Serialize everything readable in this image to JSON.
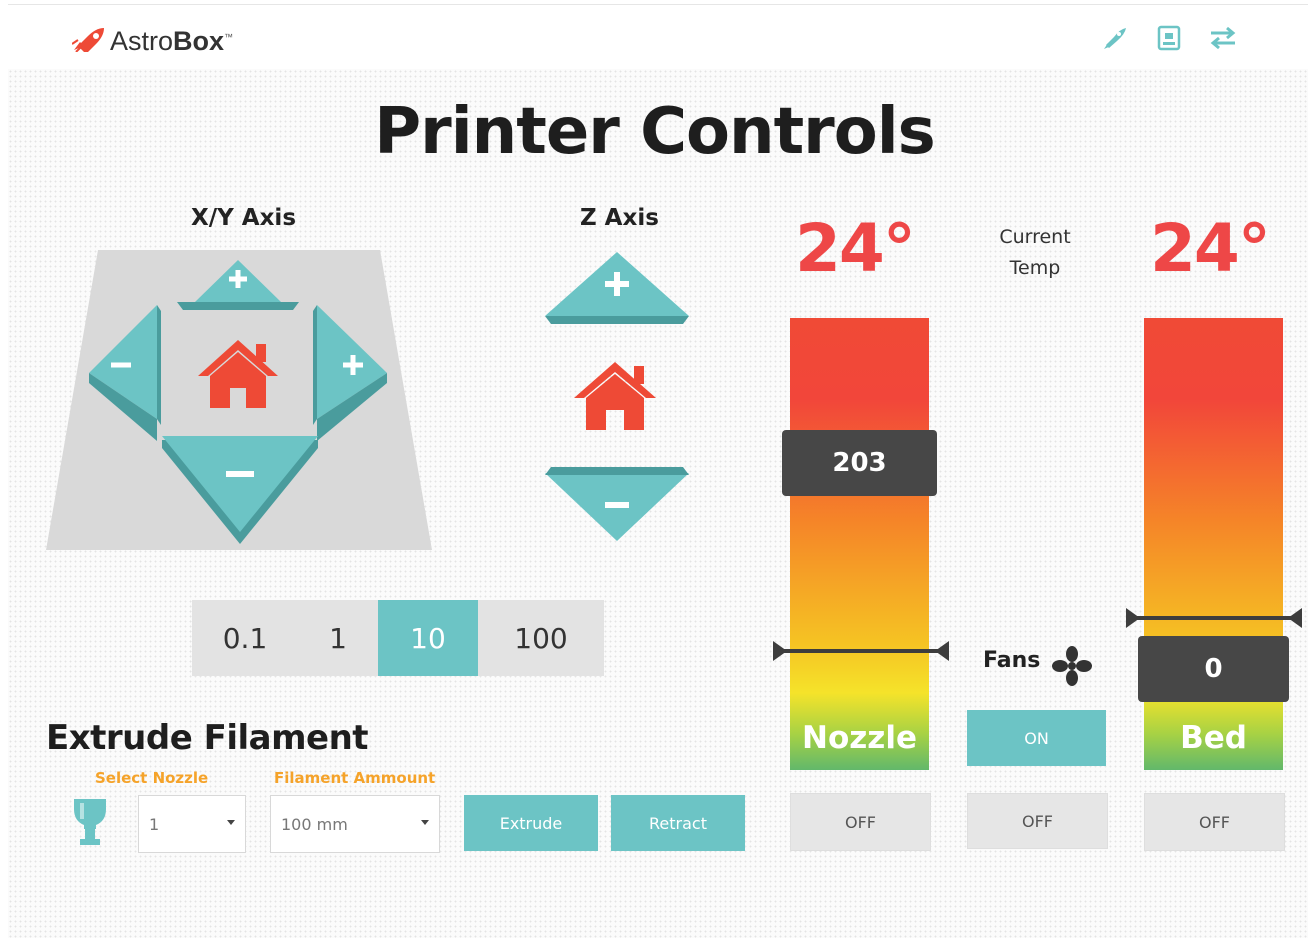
{
  "app": {
    "brand_light": "Astro",
    "brand_bold": "Box",
    "trademark": "™"
  },
  "topbar": {
    "icons": [
      "rocket-icon",
      "printer-icon",
      "transfer-icon"
    ]
  },
  "page": {
    "title": "Printer Controls"
  },
  "xy_axis": {
    "label": "X/Y Axis",
    "up": "+",
    "down": "−",
    "left": "−",
    "right": "+"
  },
  "z_axis": {
    "label": "Z Axis",
    "up": "+",
    "down": "−"
  },
  "step_sizes": {
    "options": [
      "0.1",
      "1",
      "10",
      "100"
    ],
    "selected": "10"
  },
  "nozzle": {
    "current": "24°",
    "target": "203",
    "label": "Nozzle",
    "off_label": "OFF",
    "target_fraction": 0.72
  },
  "bed": {
    "current": "24°",
    "target": "0",
    "label": "Bed",
    "off_label": "OFF",
    "target_fraction": 0.66
  },
  "current_temp": {
    "line1": "Current",
    "line2": "Temp"
  },
  "fans": {
    "label": "Fans",
    "on_label": "ON",
    "off_label": "OFF"
  },
  "extrude": {
    "title": "Extrude Filament",
    "nozzle_label": "Select Nozzle",
    "nozzle_value": "1",
    "amount_label": "Filament Ammount",
    "amount_value": "100 mm",
    "extrude_button": "Extrude",
    "retract_button": "Retract"
  },
  "colors": {
    "accent": "#6cc4c5",
    "home": "#ee4a36",
    "temp": "#ee4747",
    "label_orange": "#f5a32a"
  }
}
